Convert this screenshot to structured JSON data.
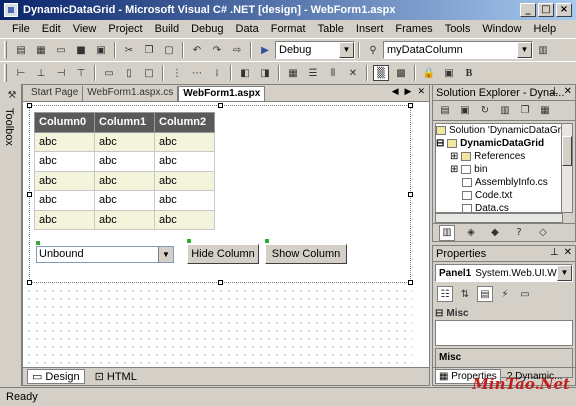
{
  "window": {
    "title": "DynamicDataGrid - Microsoft Visual C# .NET [design] - WebForm1.aspx",
    "buttons": [
      "_",
      "□",
      "×"
    ]
  },
  "menu": [
    "File",
    "Edit",
    "View",
    "Project",
    "Build",
    "Debug",
    "Data",
    "Format",
    "Table",
    "Insert",
    "Frames",
    "Tools",
    "Window",
    "Help"
  ],
  "toolbar": {
    "config_value": "Debug",
    "find_value": "myDataColumn"
  },
  "toolbox": {
    "label": "Toolbox"
  },
  "doc_tabs": [
    "Start Page",
    "WebForm1.aspx.cs",
    "WebForm1.aspx"
  ],
  "grid": {
    "headers": [
      "Column0",
      "Column1",
      "Column2"
    ],
    "rows": [
      [
        "abc",
        "abc",
        "abc"
      ],
      [
        "abc",
        "abc",
        "abc"
      ],
      [
        "abc",
        "abc",
        "abc"
      ],
      [
        "abc",
        "abc",
        "abc"
      ],
      [
        "abc",
        "abc",
        "abc"
      ]
    ]
  },
  "form": {
    "dropdown_value": "Unbound",
    "hide_label": "Hide Column",
    "show_label": "Show Column"
  },
  "view_tabs": [
    "Design",
    "HTML"
  ],
  "solution_explorer": {
    "title": "Solution Explorer - Dyna...",
    "nodes": [
      "Solution 'DynamicDataGrid'",
      "DynamicDataGrid",
      "References",
      "bin",
      "AssemblyInfo.cs",
      "Code.txt",
      "Data.cs"
    ]
  },
  "properties": {
    "title": "Properties",
    "object": "Panel1",
    "object_type": "System.Web.UI.We",
    "category": "Misc",
    "description_title": "Misc",
    "tabs": [
      "Properties",
      "Dynamic..."
    ]
  },
  "status": "Ready",
  "watermark": "MinTao.Net"
}
